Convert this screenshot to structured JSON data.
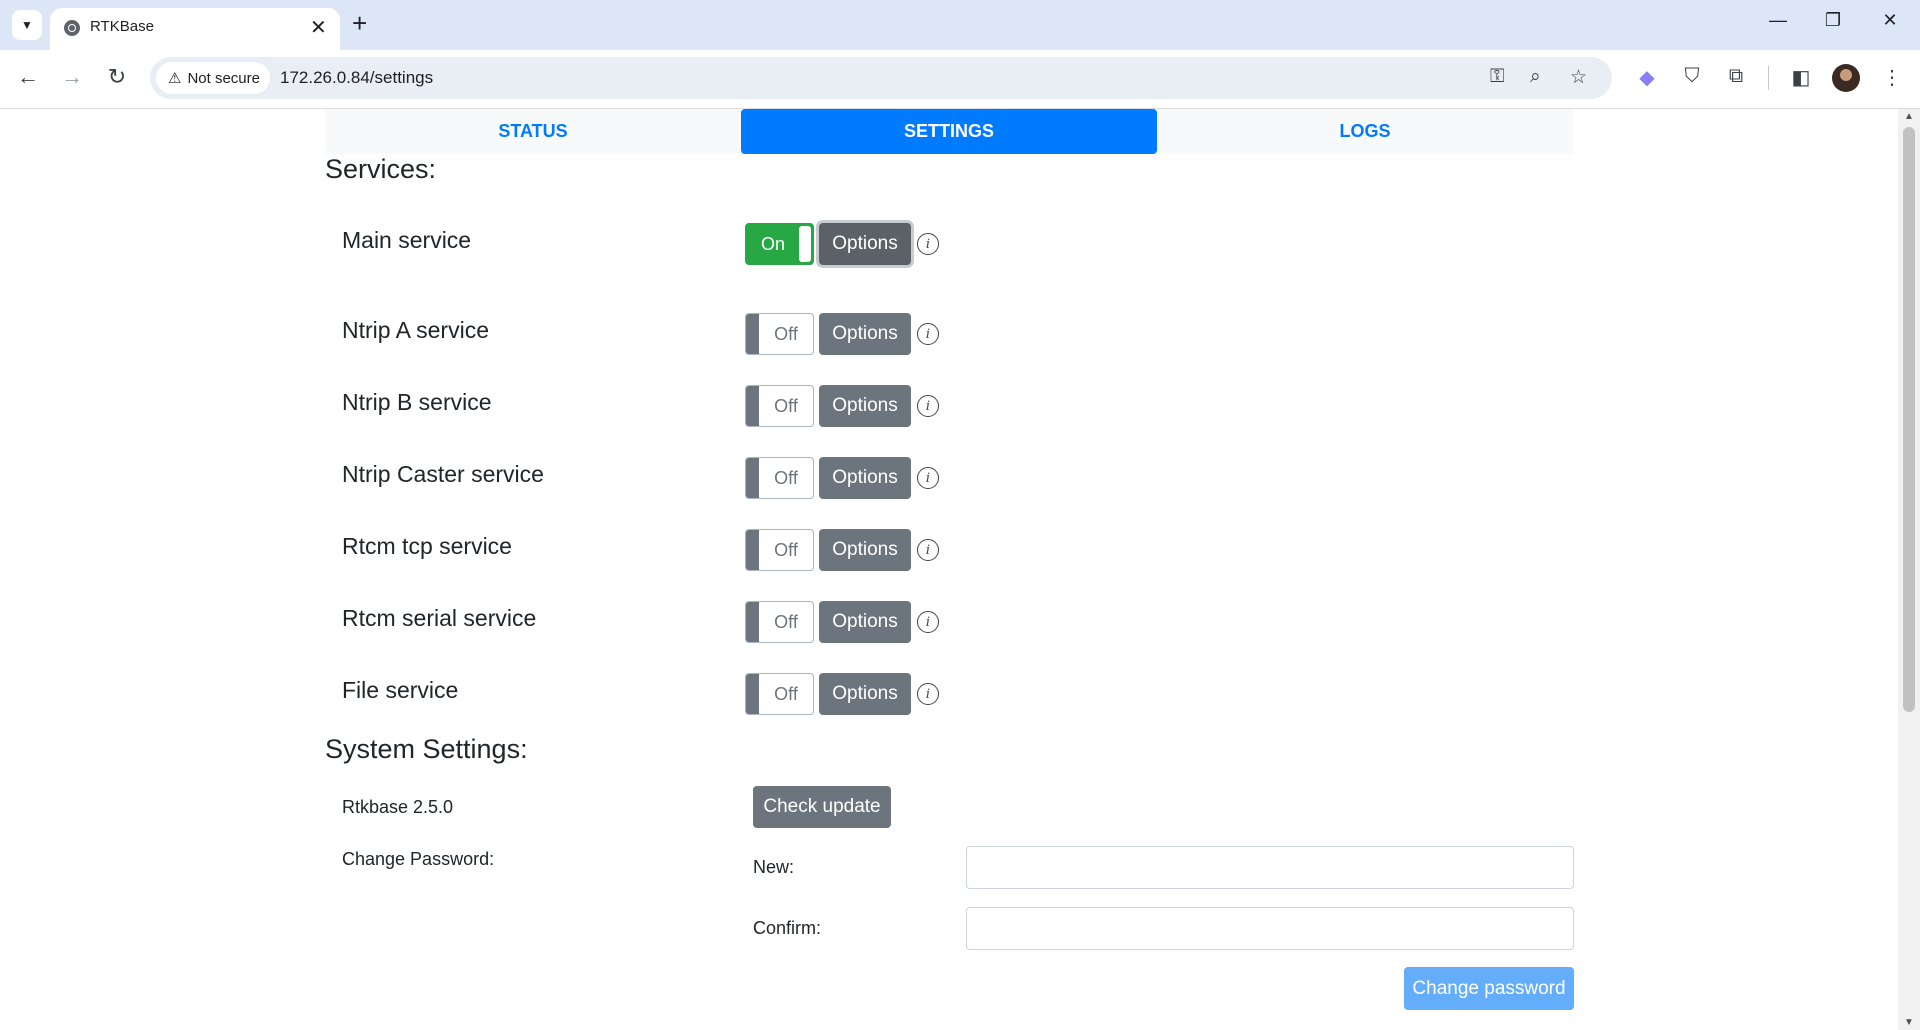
{
  "browser": {
    "tab_title": "RTKBase",
    "tab_close": "✕",
    "new_tab": "+",
    "security_label": "Not secure",
    "url": "172.26.0.84/settings",
    "window_controls": {
      "minimize": "—",
      "restore": "❐",
      "close": "✕"
    },
    "icons": [
      "tab-search-icon",
      "globe-favicon-icon",
      "back-icon",
      "forward-icon",
      "reload-icon",
      "warning-icon",
      "key-icon",
      "zoom-icon",
      "star-icon",
      "extension-bird-icon",
      "shield-icon",
      "puzzle-icon",
      "side-panel-icon",
      "avatar"
    ]
  },
  "nav": {
    "tabs": [
      {
        "label": "STATUS",
        "active": false
      },
      {
        "label": "SETTINGS",
        "active": true
      },
      {
        "label": "LOGS",
        "active": false
      }
    ]
  },
  "services": {
    "heading": "Services:",
    "items": [
      {
        "label": "Main service",
        "state": "On",
        "options": "Options"
      },
      {
        "label": "Ntrip A service",
        "state": "Off",
        "options": "Options"
      },
      {
        "label": "Ntrip B service",
        "state": "Off",
        "options": "Options"
      },
      {
        "label": "Ntrip Caster service",
        "state": "Off",
        "options": "Options"
      },
      {
        "label": "Rtcm tcp service",
        "state": "Off",
        "options": "Options"
      },
      {
        "label": "Rtcm serial service",
        "state": "Off",
        "options": "Options"
      },
      {
        "label": "File service",
        "state": "Off",
        "options": "Options"
      }
    ]
  },
  "system": {
    "heading": "System Settings:",
    "version": "Rtkbase 2.5.0",
    "check_update": "Check update",
    "change_password_label": "Change Password:",
    "new_label": "New:",
    "confirm_label": "Confirm:",
    "new_value": "",
    "confirm_value": "",
    "change_password_button": "Change password"
  },
  "colors": {
    "primary": "#007bff",
    "success": "#28a745",
    "secondary": "#6c757d",
    "disabled_primary": "#63adfb"
  }
}
